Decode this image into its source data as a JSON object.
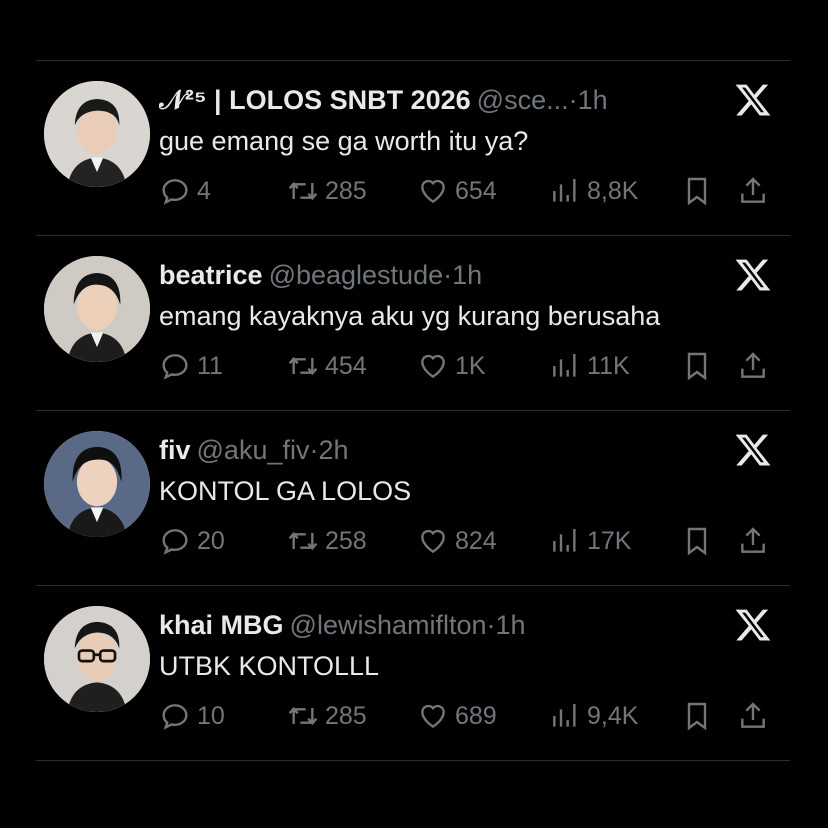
{
  "tweets": [
    {
      "name": "𝒩²⁵ | LOLOS SNBT 2026",
      "handle": "@sce...",
      "dot": "·",
      "time": "1h",
      "text": "gue emang se ga worth itu ya?",
      "replies": "4",
      "retweets": "285",
      "likes": "654",
      "views": "8,8K"
    },
    {
      "name": "beatrice",
      "handle": "@beaglestude",
      "dot": "·",
      "time": "1h",
      "text": "emang kayaknya aku yg kurang berusaha",
      "replies": "11",
      "retweets": "454",
      "likes": "1K",
      "views": "11K"
    },
    {
      "name": "fiv",
      "handle": "@aku_fiv",
      "dot": "·",
      "time": "2h",
      "text": "KONTOL GA LOLOS",
      "replies": "20",
      "retweets": "258",
      "likes": "824",
      "views": "17K"
    },
    {
      "name": "khai MBG",
      "handle": "@lewishamiflton",
      "dot": "·",
      "time": "1h",
      "text": "UTBK KONTOLLL",
      "replies": "10",
      "retweets": "285",
      "likes": "689",
      "views": "9,4K"
    }
  ],
  "icons": {
    "brand": "x-logo-icon",
    "reply": "reply-icon",
    "retweet": "retweet-icon",
    "like": "heart-icon",
    "views": "views-icon",
    "bookmark": "bookmark-icon",
    "share": "share-icon"
  },
  "colors": {
    "background": "#000000",
    "text": "#e7e9ea",
    "muted": "#71767b",
    "divider": "#2a2d31"
  }
}
